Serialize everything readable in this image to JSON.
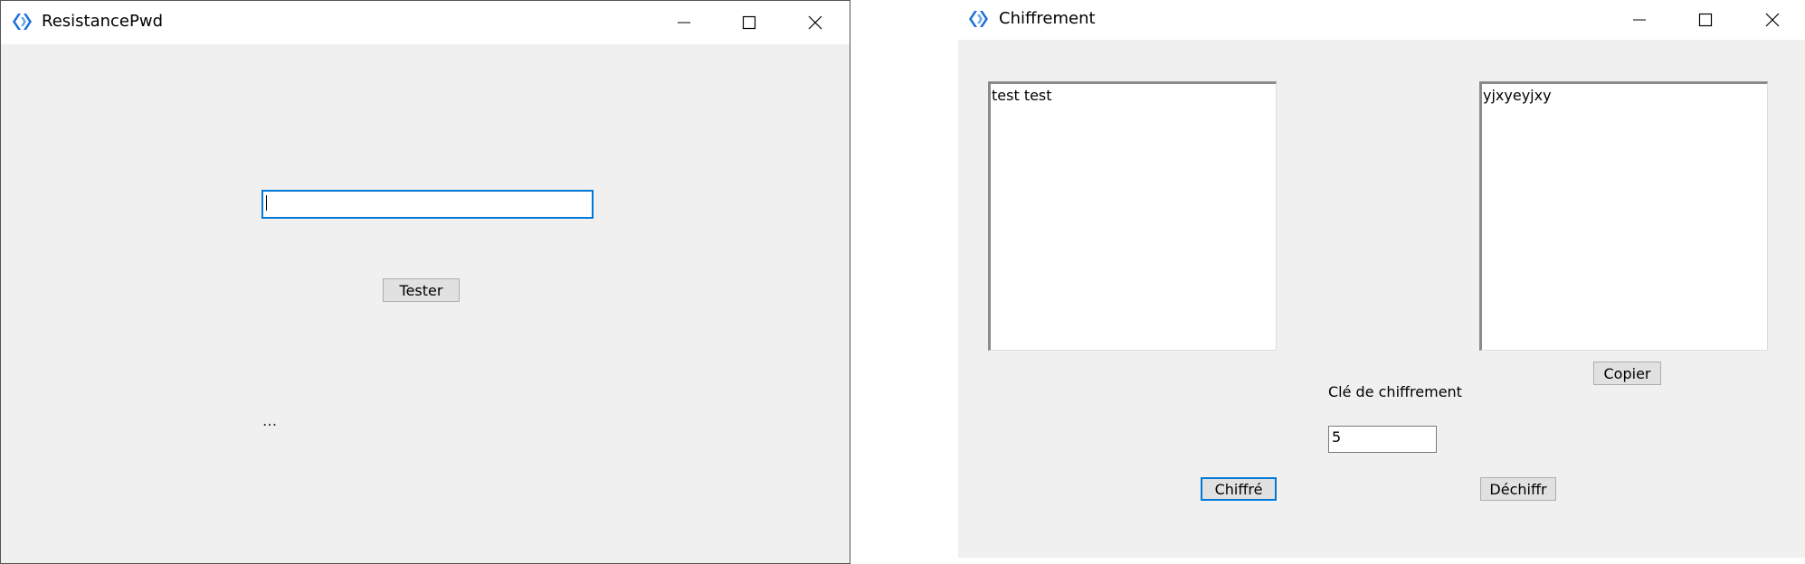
{
  "resistance_window": {
    "title": "ResistancePwd",
    "password_input": {
      "value": ""
    },
    "test_button_label": "Tester",
    "result_text": "..."
  },
  "cipher_window": {
    "title": "Chiffrement",
    "input_text": "test test",
    "output_text": "yjxyeyjxy",
    "copy_button_label": "Copier",
    "key_label": "Clé de chiffrement",
    "key_value": "5",
    "encrypt_button_label": "Chiffré",
    "decrypt_button_label": "Déchiffr"
  },
  "window_controls": {
    "minimize_icon": "minimize-icon",
    "maximize_icon": "maximize-icon",
    "close_icon": "close-icon"
  },
  "colors": {
    "focus": "#0078d7",
    "window_bg": "#f0f0f0",
    "icon_blue": "#1e6fd9"
  }
}
